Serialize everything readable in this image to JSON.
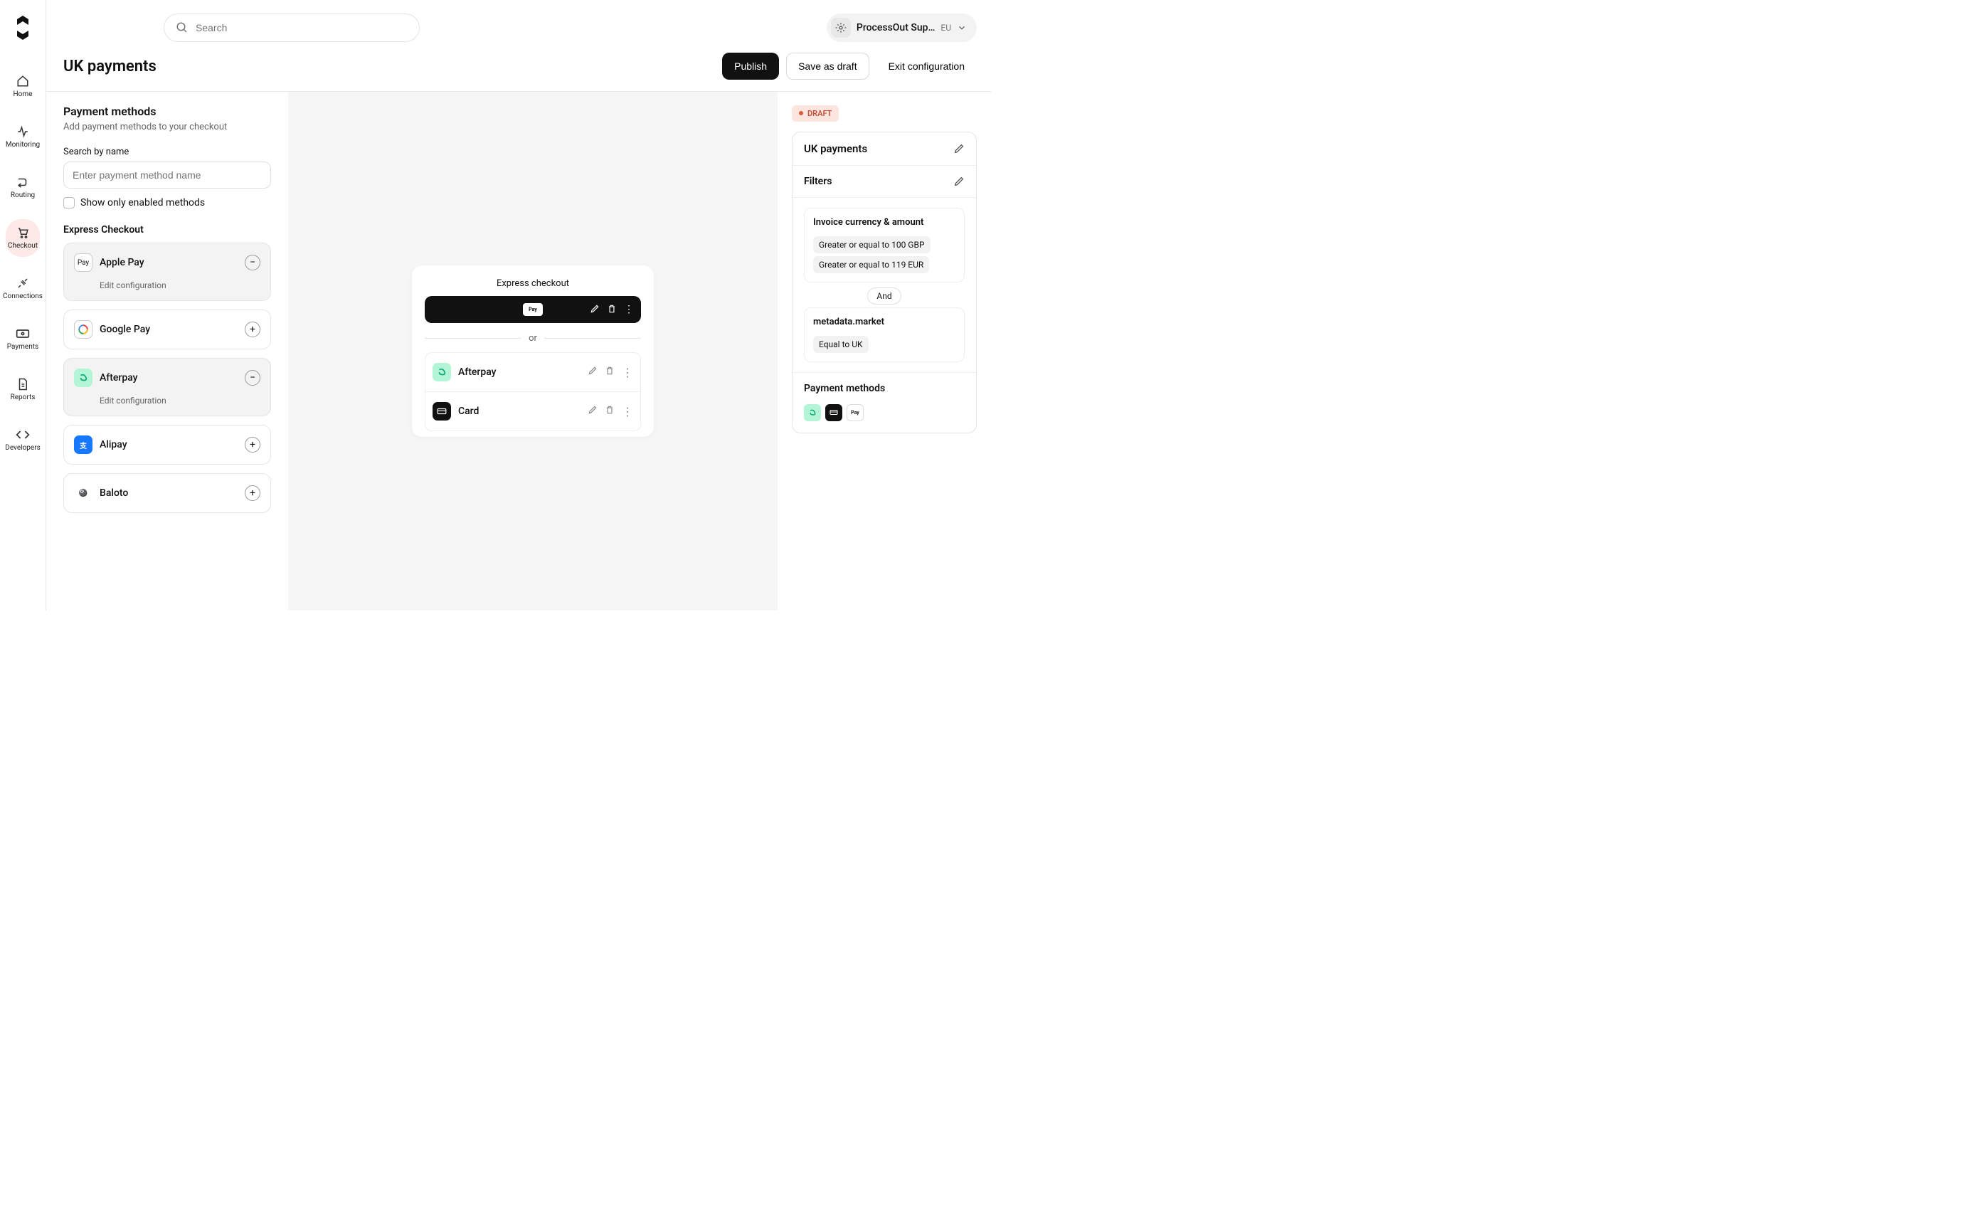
{
  "search": {
    "placeholder": "Search"
  },
  "account": {
    "name": "ProcessOut Sup…",
    "region": "EU"
  },
  "nav": {
    "home": "Home",
    "monitoring": "Monitoring",
    "routing": "Routing",
    "checkout": "Checkout",
    "connections": "Connections",
    "payments": "Payments",
    "reports": "Reports",
    "developers": "Developers"
  },
  "page": {
    "title": "UK payments",
    "publish": "Publish",
    "save_draft": "Save as draft",
    "exit": "Exit configuration"
  },
  "left": {
    "section_title": "Payment methods",
    "section_desc": "Add payment methods to your checkout",
    "search_label": "Search by name",
    "search_placeholder": "Enter payment method name",
    "checkbox_label": "Show only enabled methods",
    "express_header": "Express Checkout",
    "edit_config": "Edit configuration",
    "methods": {
      "apple_pay": "Apple Pay",
      "google_pay": "Google Pay",
      "afterpay": "Afterpay",
      "alipay": "Alipay",
      "baloto": "Baloto"
    }
  },
  "preview": {
    "title": "Express checkout",
    "or": "or",
    "afterpay": "Afterpay",
    "card": "Card"
  },
  "right": {
    "status": "DRAFT",
    "title": "UK payments",
    "filters_label": "Filters",
    "filter1_label": "Invoice currency & amount",
    "filter1_chip1": "Greater or equal to 100 GBP",
    "filter1_chip2": "Greater or equal to 119 EUR",
    "and": "And",
    "filter2_label": "metadata.market",
    "filter2_chip1": "Equal to UK",
    "pm_label": "Payment methods"
  }
}
